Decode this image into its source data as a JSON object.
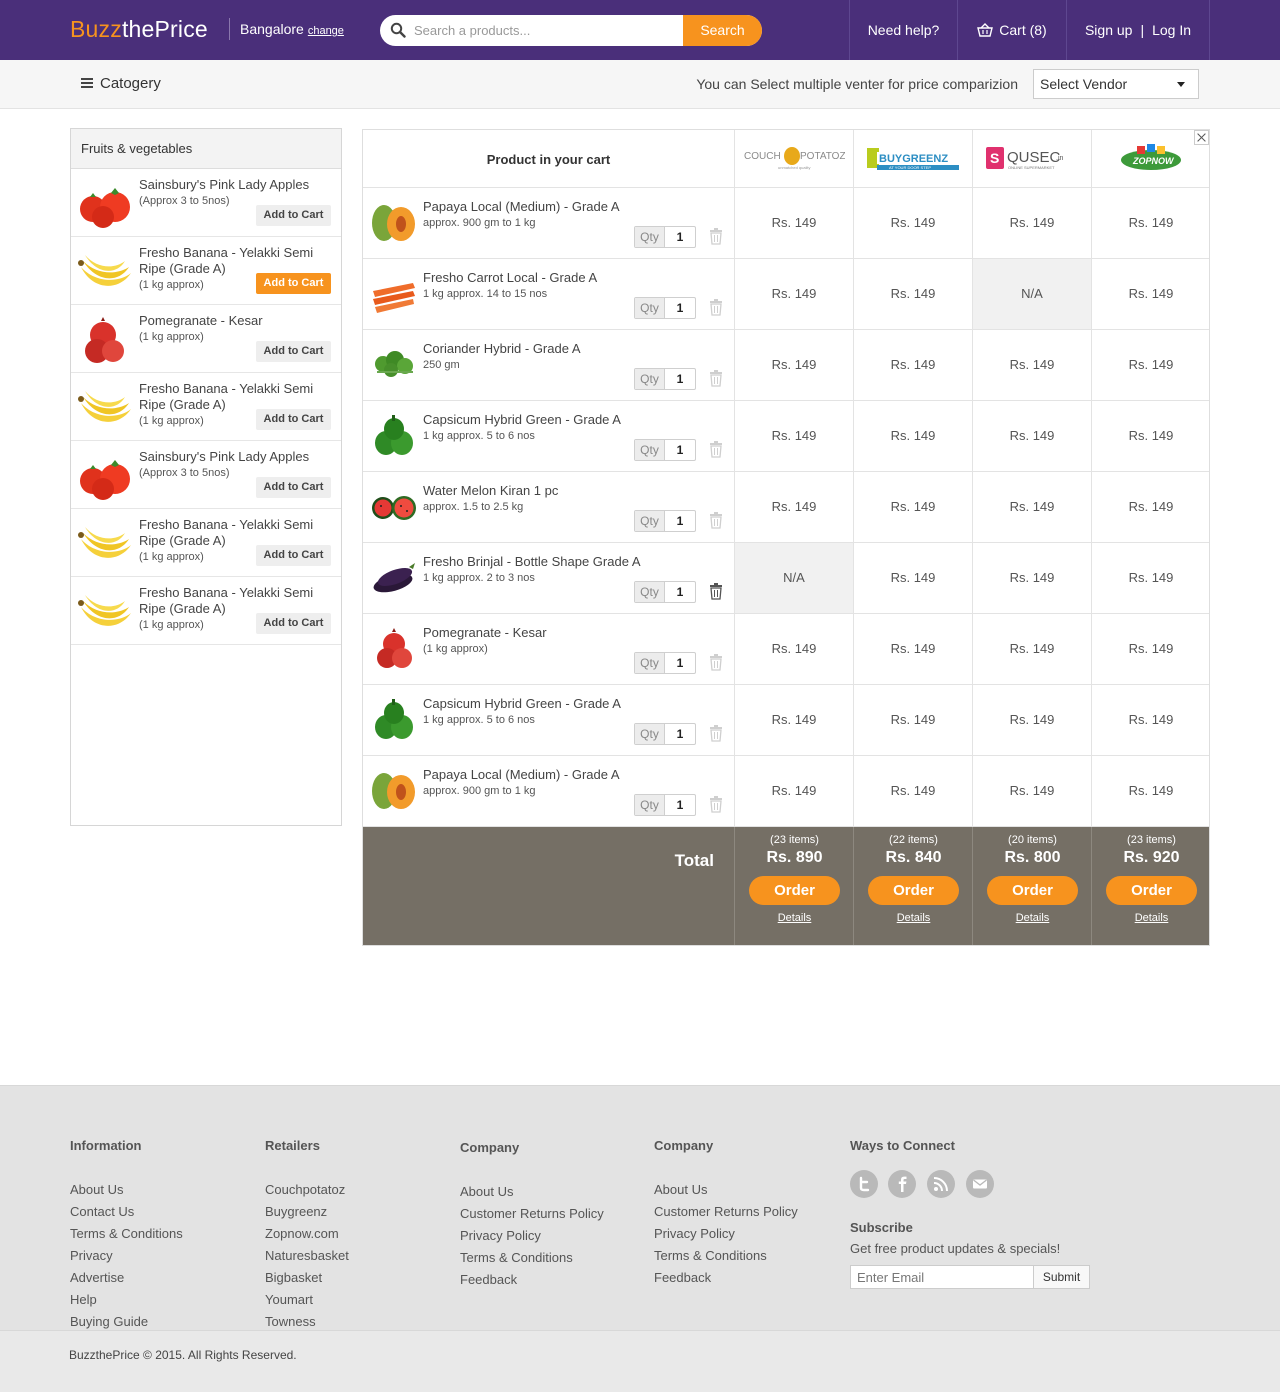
{
  "header": {
    "logo_part1": "Buzz",
    "logo_part2": "thePrice",
    "city": "Bangalore",
    "change_label": "change",
    "search_placeholder": "Search a products...",
    "search_button": "Search",
    "help_label": "Need help?",
    "cart_label": "Cart (8)",
    "signup_label": "Sign up",
    "auth_separator": "|",
    "login_label": "Log In",
    "brand_color": "#4a2f7a",
    "accent_color": "#f7931e"
  },
  "catbar": {
    "category_label": "Catogery",
    "vendor_hint": "You can Select multiple venter for price comparizion",
    "vendor_select": "Select Vendor"
  },
  "sidebar": {
    "title": "Fruits & vegetables",
    "items": [
      {
        "name": "Sainsbury's Pink Lady Apples",
        "note": "(Approx 3 to 5nos)",
        "button": "Add to Cart",
        "icon": "tomato-icon"
      },
      {
        "name": "Fresho Banana - Yelakki Semi Ripe (Grade A)",
        "note": "(1 kg approx)",
        "button": "Add to Cart",
        "icon": "banana-icon"
      },
      {
        "name": "Pomegranate - Kesar",
        "note": "(1 kg approx)",
        "button": "Add to Cart",
        "icon": "pomegranate-icon"
      },
      {
        "name": "Fresho Banana - Yelakki Semi Ripe (Grade A)",
        "note": "(1 kg approx)",
        "button": "Add to Cart",
        "icon": "banana-icon"
      },
      {
        "name": "Sainsbury's Pink Lady Apples",
        "note": "(Approx 3 to 5nos)",
        "button": "Add to Cart",
        "icon": "tomato-icon"
      },
      {
        "name": "Fresho Banana - Yelakki Semi Ripe (Grade A)",
        "note": "(1 kg approx)",
        "button": "Add to Cart",
        "icon": "banana-icon"
      },
      {
        "name": "Fresho Banana - Yelakki Semi Ripe (Grade A)",
        "note": "(1 kg approx)",
        "button": "Add to Cart",
        "icon": "banana-icon"
      }
    ]
  },
  "cart": {
    "header_label": "Product in your cart",
    "vendors": [
      {
        "part1": "COUCH",
        "part2": "POTATOZ",
        "tagline": "unmatched quality"
      },
      {
        "part1": "BUYGREENZ",
        "tagline": "AT YOUR DOOR STEP"
      },
      {
        "part1": "QUSEC",
        "part2": ".in",
        "tagline": "ONLINE SUPERMARKET"
      },
      {
        "part1": "ZOPNOW"
      }
    ],
    "qty_label": "Qty",
    "rows": [
      {
        "name": "Papaya Local (Medium) - Grade A",
        "sub": "approx. 900 gm to 1 kg",
        "qty": "1",
        "icon": "papaya-icon",
        "prices": [
          "Rs. 149",
          "Rs. 149",
          "Rs. 149",
          "Rs. 149"
        ]
      },
      {
        "name": "Fresho Carrot Local - Grade A",
        "sub": "1 kg approx. 14 to 15 nos",
        "qty": "1",
        "icon": "carrot-icon",
        "prices": [
          "Rs. 149",
          "Rs. 149",
          "N/A",
          "Rs. 149"
        ]
      },
      {
        "name": "Coriander Hybrid - Grade A",
        "sub": "250 gm",
        "qty": "1",
        "icon": "coriander-icon",
        "prices": [
          "Rs. 149",
          "Rs. 149",
          "Rs. 149",
          "Rs. 149"
        ]
      },
      {
        "name": "Capsicum Hybrid Green - Grade A",
        "sub": "1 kg approx. 5 to 6 nos",
        "qty": "1",
        "icon": "capsicum-icon",
        "prices": [
          "Rs. 149",
          "Rs. 149",
          "Rs. 149",
          "Rs. 149"
        ]
      },
      {
        "name": "Water Melon Kiran 1 pc",
        "sub": "approx. 1.5 to 2.5 kg",
        "qty": "1",
        "icon": "watermelon-icon",
        "prices": [
          "Rs. 149",
          "Rs. 149",
          "Rs. 149",
          "Rs. 149"
        ]
      },
      {
        "name": "Fresho Brinjal - Bottle Shape Grade A",
        "sub": "1 kg approx. 2 to 3 nos",
        "qty": "1",
        "icon": "brinjal-icon",
        "prices": [
          "N/A",
          "Rs. 149",
          "Rs. 149",
          "Rs. 149"
        ]
      },
      {
        "name": "Pomegranate - Kesar",
        "sub": "(1 kg approx)",
        "qty": "1",
        "icon": "pomegranate-icon",
        "prices": [
          "Rs. 149",
          "Rs. 149",
          "Rs. 149",
          "Rs. 149"
        ]
      },
      {
        "name": "Capsicum Hybrid Green - Grade A",
        "sub": "1 kg approx. 5 to 6 nos",
        "qty": "1",
        "icon": "capsicum-icon",
        "prices": [
          "Rs. 149",
          "Rs. 149",
          "Rs. 149",
          "Rs. 149"
        ]
      },
      {
        "name": "Papaya Local (Medium) - Grade A",
        "sub": "approx. 900 gm to 1 kg",
        "qty": "1",
        "icon": "papaya-icon",
        "prices": [
          "Rs. 149",
          "Rs. 149",
          "Rs. 149",
          "Rs. 149"
        ]
      }
    ],
    "total_label": "Total",
    "totals": [
      {
        "items": "(23 items)",
        "amount": "Rs. 890",
        "order": "Order",
        "details": "Details"
      },
      {
        "items": "(22 items)",
        "amount": "Rs. 840",
        "order": "Order",
        "details": "Details"
      },
      {
        "items": "(20 items)",
        "amount": "Rs. 800",
        "order": "Order",
        "details": "Details"
      },
      {
        "items": "(23 items)",
        "amount": "Rs. 920",
        "order": "Order",
        "details": "Details"
      }
    ]
  },
  "footer": {
    "columns": [
      {
        "title": "Information",
        "links": [
          "About Us",
          "Contact Us",
          "Terms & Conditions",
          "Privacy",
          "Advertise",
          "Help",
          "Buying Guide"
        ]
      },
      {
        "title": "Retailers",
        "links": [
          "Couchpotatoz",
          "Buygreenz",
          "Zopnow.com",
          "Naturesbasket",
          "Bigbasket",
          "Youmart",
          "Towness"
        ]
      },
      {
        "title": "Company",
        "links": [
          "About Us",
          "Customer Returns Policy",
          "Privacy Policy",
          "Terms & Conditions",
          "Feedback"
        ]
      },
      {
        "title": "Company",
        "links": [
          "About Us",
          "Customer Returns Policy",
          "Privacy Policy",
          "Terms & Conditions",
          "Feedback"
        ]
      }
    ],
    "connect_title": "Ways to Connect",
    "social_icons": [
      "twitter-icon",
      "facebook-icon",
      "rss-icon",
      "mail-icon"
    ],
    "subscribe_title": "Subscribe",
    "subscribe_text": "Get free product updates & specials!",
    "email_placeholder": "Enter Email",
    "submit_label": "Submit",
    "copyright": "BuzzthePrice © 2015. All Rights Reserved."
  }
}
